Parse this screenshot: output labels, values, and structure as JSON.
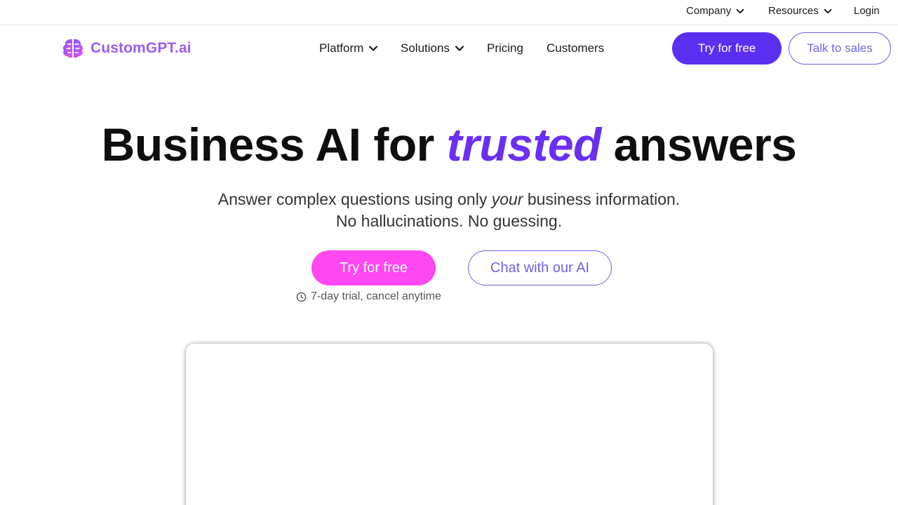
{
  "topbar": {
    "items": [
      {
        "label": "Company",
        "has_dropdown": true
      },
      {
        "label": "Resources",
        "has_dropdown": true
      },
      {
        "label": "Login",
        "has_dropdown": false
      }
    ]
  },
  "brand": {
    "name": "CustomGPT.ai",
    "logo_icon": "brain-icon",
    "color": "#9b5cf0"
  },
  "nav": {
    "items": [
      {
        "label": "Platform",
        "has_dropdown": true
      },
      {
        "label": "Solutions",
        "has_dropdown": true
      },
      {
        "label": "Pricing",
        "has_dropdown": false
      },
      {
        "label": "Customers",
        "has_dropdown": false
      }
    ],
    "primary_button": "Try for free",
    "secondary_button": "Talk to sales"
  },
  "hero": {
    "title_before": "Business AI for ",
    "title_accent": "trusted",
    "title_after": " answers",
    "subtitle_line1_before": "Answer complex questions using only ",
    "subtitle_line1_em": "your",
    "subtitle_line1_after": " business information.",
    "subtitle_line2": "No hallucinations. No guessing.",
    "cta_primary": "Try for free",
    "cta_secondary": "Chat with our AI",
    "trial_note": "7-day trial, cancel anytime",
    "trial_icon": "clock-icon"
  },
  "colors": {
    "primary": "#5b2ff0",
    "accent_text": "#6a2ff2",
    "cta_pink": "#ff47f2",
    "outline": "#6e63e6"
  }
}
